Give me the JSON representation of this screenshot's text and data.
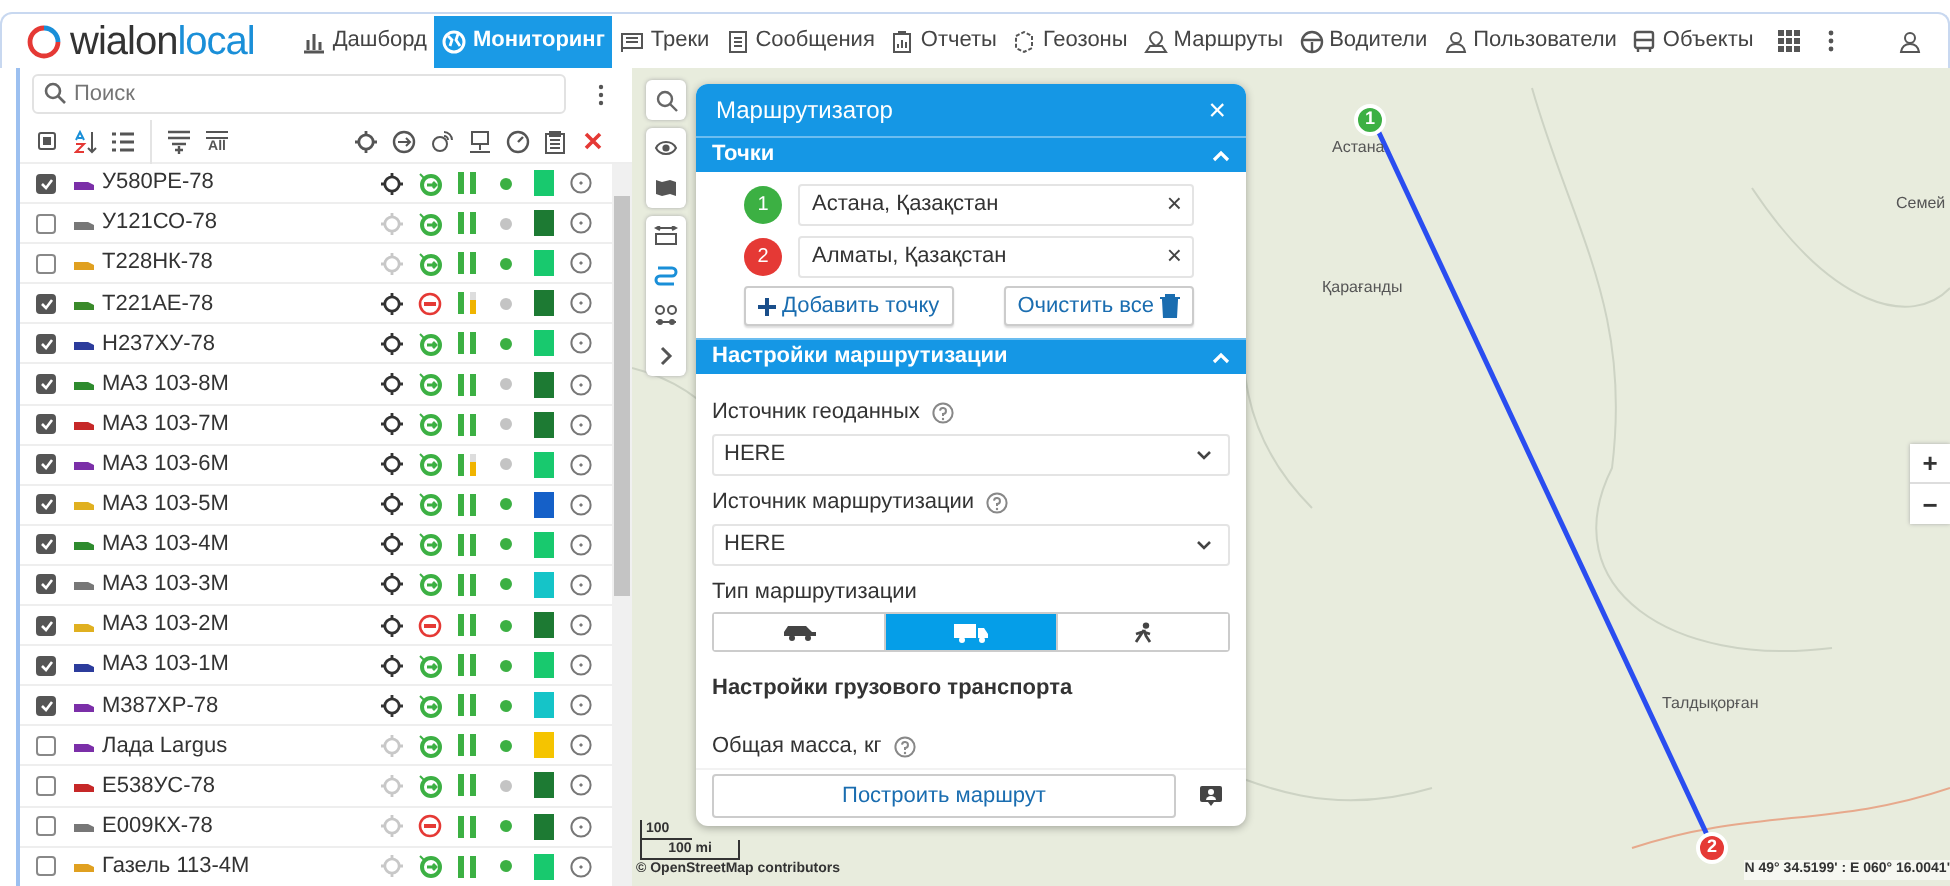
{
  "header": {
    "logo": {
      "part1": "wialon",
      "part2": "local"
    },
    "nav": [
      {
        "label": "Дашборд",
        "kind": "chart",
        "selected": false
      },
      {
        "label": "Мониторинг",
        "kind": "globe",
        "selected": true
      },
      {
        "label": "Треки",
        "kind": "track",
        "selected": false
      },
      {
        "label": "Сообщения",
        "kind": "doc",
        "selected": false
      },
      {
        "label": "Отчеты",
        "kind": "report",
        "selected": false
      },
      {
        "label": "Геозоны",
        "kind": "zone",
        "selected": false
      },
      {
        "label": "Маршруты",
        "kind": "route",
        "selected": false
      },
      {
        "label": "Водители",
        "kind": "wheel",
        "selected": false
      },
      {
        "label": "Пользователи",
        "kind": "user",
        "selected": false
      },
      {
        "label": "Объекты",
        "kind": "bus",
        "selected": false
      }
    ]
  },
  "units_panel": {
    "search": {
      "placeholder": "Поиск"
    },
    "toolbar": {
      "all_label": "All"
    },
    "units": [
      {
        "name": "У580РЕ-78",
        "checked": true,
        "located": true,
        "moving": true,
        "weak_signal": false,
        "vehicle": {
          "color": "#7b2fa8"
        },
        "dot": {
          "color": "#3cb043"
        },
        "status": {
          "color": "#18c96e"
        }
      },
      {
        "name": "У121СО-78",
        "checked": false,
        "located": false,
        "moving": true,
        "weak_signal": false,
        "vehicle": {
          "color": "#777777"
        },
        "dot": {
          "color": "#c4c4c4"
        },
        "status": {
          "color": "#1d7a33"
        }
      },
      {
        "name": "Т228НК-78",
        "checked": false,
        "located": false,
        "moving": true,
        "weak_signal": false,
        "vehicle": {
          "color": "#e0a020"
        },
        "dot": {
          "color": "#3cb043"
        },
        "status": {
          "color": "#18c96e"
        }
      },
      {
        "name": "Т221АЕ-78",
        "checked": true,
        "located": true,
        "moving": false,
        "weak_signal": true,
        "vehicle": {
          "color": "#3a8a2a"
        },
        "dot": {
          "color": "#c4c4c4"
        },
        "status": {
          "color": "#1d7a33"
        }
      },
      {
        "name": "Н237ХУ-78",
        "checked": true,
        "located": true,
        "moving": true,
        "weak_signal": false,
        "vehicle": {
          "color": "#2c3c9c"
        },
        "dot": {
          "color": "#3cb043"
        },
        "status": {
          "color": "#18c96e"
        }
      },
      {
        "name": "МАЗ 103-8М",
        "checked": true,
        "located": true,
        "moving": true,
        "weak_signal": false,
        "vehicle": {
          "color": "#2e8b2e"
        },
        "dot": {
          "color": "#c4c4c4"
        },
        "status": {
          "color": "#1d7a33"
        }
      },
      {
        "name": "МАЗ 103-7М",
        "checked": true,
        "located": true,
        "moving": true,
        "weak_signal": false,
        "vehicle": {
          "color": "#c62828"
        },
        "dot": {
          "color": "#c4c4c4"
        },
        "status": {
          "color": "#1d7a33"
        }
      },
      {
        "name": "МАЗ 103-6М",
        "checked": true,
        "located": true,
        "moving": true,
        "weak_signal": true,
        "vehicle": {
          "color": "#7b2fa8"
        },
        "dot": {
          "color": "#c4c4c4"
        },
        "status": {
          "color": "#18c96e"
        }
      },
      {
        "name": "МАЗ 103-5М",
        "checked": true,
        "located": true,
        "moving": true,
        "weak_signal": false,
        "vehicle": {
          "color": "#e0b020"
        },
        "dot": {
          "color": "#3cb043"
        },
        "status": {
          "color": "#1560c8"
        }
      },
      {
        "name": "МАЗ 103-4М",
        "checked": true,
        "located": true,
        "moving": true,
        "weak_signal": false,
        "vehicle": {
          "color": "#2e8b2e"
        },
        "dot": {
          "color": "#3cb043"
        },
        "status": {
          "color": "#18c96e"
        }
      },
      {
        "name": "МАЗ 103-3М",
        "checked": true,
        "located": true,
        "moving": true,
        "weak_signal": false,
        "vehicle": {
          "color": "#777777"
        },
        "dot": {
          "color": "#3cb043"
        },
        "status": {
          "color": "#15c4c8"
        }
      },
      {
        "name": "МАЗ 103-2М",
        "checked": true,
        "located": true,
        "moving": false,
        "weak_signal": false,
        "vehicle": {
          "color": "#e0b020"
        },
        "dot": {
          "color": "#3cb043"
        },
        "status": {
          "color": "#1d7a33"
        }
      },
      {
        "name": "МАЗ 103-1М",
        "checked": true,
        "located": true,
        "moving": true,
        "weak_signal": false,
        "vehicle": {
          "color": "#2c3c9c"
        },
        "dot": {
          "color": "#3cb043"
        },
        "status": {
          "color": "#18c96e"
        }
      },
      {
        "name": "М387ХР-78",
        "checked": true,
        "located": true,
        "moving": true,
        "weak_signal": false,
        "vehicle": {
          "color": "#7b2fa8"
        },
        "dot": {
          "color": "#3cb043"
        },
        "status": {
          "color": "#15c4c8"
        }
      },
      {
        "name": "Лада Largus",
        "checked": false,
        "located": false,
        "moving": true,
        "weak_signal": false,
        "vehicle": {
          "color": "#7b2fa8"
        },
        "dot": {
          "color": "#3cb043"
        },
        "status": {
          "color": "#f5c400"
        }
      },
      {
        "name": "Е538УС-78",
        "checked": false,
        "located": false,
        "moving": true,
        "weak_signal": false,
        "vehicle": {
          "color": "#c62828"
        },
        "dot": {
          "color": "#c4c4c4"
        },
        "status": {
          "color": "#1d7a33"
        }
      },
      {
        "name": "Е009КХ-78",
        "checked": false,
        "located": false,
        "moving": false,
        "weak_signal": false,
        "vehicle": {
          "color": "#777777"
        },
        "dot": {
          "color": "#3cb043"
        },
        "status": {
          "color": "#1d7a33"
        }
      },
      {
        "name": "Газель 113-4М",
        "checked": false,
        "located": false,
        "moving": true,
        "weak_signal": false,
        "vehicle": {
          "color": "#e0a020"
        },
        "dot": {
          "color": "#3cb043"
        },
        "status": {
          "color": "#18c96e"
        }
      }
    ]
  },
  "map": {
    "labels": [
      "Астана",
      "Қарағанды",
      "Семей",
      "Талдықорған"
    ],
    "markers": [
      {
        "label": "1",
        "color": "#3cb043"
      },
      {
        "label": "2",
        "color": "#e53935"
      }
    ],
    "scale": [
      "100",
      "100 mi"
    ],
    "attribution": "© OpenStreetMap contributors",
    "coordinates": "N 49° 34.5199' : E 060° 16.0041'",
    "zoom": [
      "+",
      "−"
    ]
  },
  "router": {
    "title": "Маршрутизатор",
    "close": "×",
    "points_section": "Точки",
    "points": [
      {
        "number": "1",
        "color": "#3cb043",
        "value": "Астана, Қазақстан"
      },
      {
        "number": "2",
        "color": "#e53935",
        "value": "Алматы, Қазақстан"
      }
    ],
    "add_button": "Добавить точку",
    "clear_button": "Очистить все",
    "settings_section": "Настройки маршрутизации",
    "geo_source": {
      "label": "Источник геоданных",
      "value": "HERE"
    },
    "routing_source": {
      "label": "Источник маршрутизации",
      "value": "HERE"
    },
    "routing_type": {
      "label": "Тип маршрутизации",
      "options": [
        {
          "kind": "car",
          "selected": false
        },
        {
          "kind": "truck",
          "selected": true
        },
        {
          "kind": "walk",
          "selected": false
        }
      ]
    },
    "truck_heading": "Настройки грузового транспорта",
    "mass_label": "Общая масса, кг",
    "build_button": "Построить маршрут"
  }
}
